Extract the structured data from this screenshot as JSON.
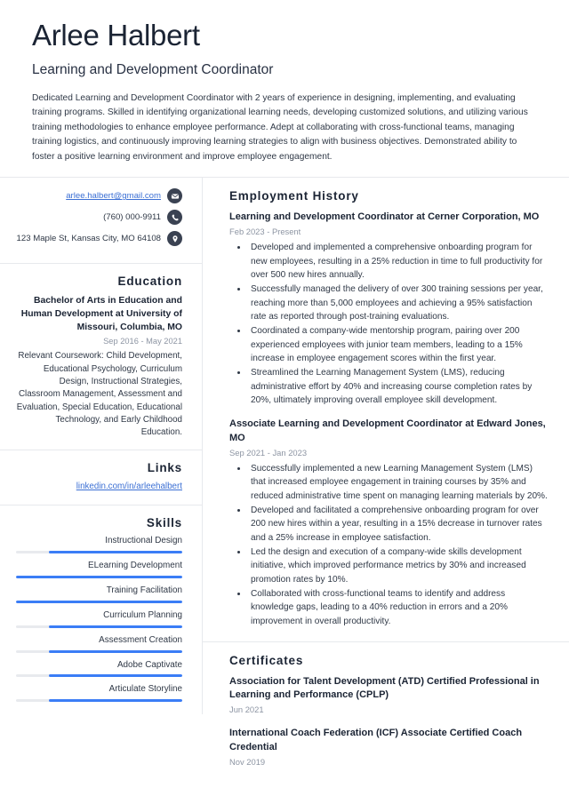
{
  "header": {
    "name": "Arlee Halbert",
    "title": "Learning and Development Coordinator",
    "summary": "Dedicated Learning and Development Coordinator with 2 years of experience in designing, implementing, and evaluating training programs. Skilled in identifying organizational learning needs, developing customized solutions, and utilizing various training methodologies to enhance employee performance. Adept at collaborating with cross-functional teams, managing training logistics, and continuously improving learning strategies to align with business objectives. Demonstrated ability to foster a positive learning environment and improve employee engagement."
  },
  "contact": {
    "email": "arlee.halbert@gmail.com",
    "phone": "(760) 000-9911",
    "address": "123 Maple St, Kansas City, MO 64108",
    "icons": {
      "email": "envelope-icon",
      "phone": "phone-icon",
      "address": "map-pin-icon"
    }
  },
  "education": {
    "heading": "Education",
    "degree": "Bachelor of Arts in Education and Human Development at University of Missouri, Columbia, MO",
    "date": "Sep 2016 - May 2021",
    "description": "Relevant Coursework: Child Development, Educational Psychology, Curriculum Design, Instructional Strategies, Classroom Management, Assessment and Evaluation, Special Education, Educational Technology, and Early Childhood Education."
  },
  "links": {
    "heading": "Links",
    "items": [
      {
        "label": "linkedin.com/in/arleehalbert"
      }
    ]
  },
  "skills": {
    "heading": "Skills",
    "accent_color": "#3b7df6",
    "track_color": "#e8eaee",
    "items": [
      {
        "name": "Instructional Design",
        "level": 80
      },
      {
        "name": "ELearning Development",
        "level": 100
      },
      {
        "name": "Training Facilitation",
        "level": 100
      },
      {
        "name": "Curriculum Planning",
        "level": 80
      },
      {
        "name": "Assessment Creation",
        "level": 80
      },
      {
        "name": "Adobe Captivate",
        "level": 80
      },
      {
        "name": "Articulate Storyline",
        "level": 80
      }
    ]
  },
  "employment": {
    "heading": "Employment History",
    "entries": [
      {
        "title": "Learning and Development Coordinator at Cerner Corporation, MO",
        "date": "Feb 2023 - Present",
        "bullets": [
          "Developed and implemented a comprehensive onboarding program for new employees, resulting in a 25% reduction in time to full productivity for over 500 new hires annually.",
          "Successfully managed the delivery of over 300 training sessions per year, reaching more than 5,000 employees and achieving a 95% satisfaction rate as reported through post-training evaluations.",
          "Coordinated a company-wide mentorship program, pairing over 200 experienced employees with junior team members, leading to a 15% increase in employee engagement scores within the first year.",
          "Streamlined the Learning Management System (LMS), reducing administrative effort by 40% and increasing course completion rates by 20%, ultimately improving overall employee skill development."
        ]
      },
      {
        "title": "Associate Learning and Development Coordinator at Edward Jones, MO",
        "date": "Sep 2021 - Jan 2023",
        "bullets": [
          "Successfully implemented a new Learning Management System (LMS) that increased employee engagement in training courses by 35% and reduced administrative time spent on managing learning materials by 20%.",
          "Developed and facilitated a comprehensive onboarding program for over 200 new hires within a year, resulting in a 15% decrease in turnover rates and a 25% increase in employee satisfaction.",
          "Led the design and execution of a company-wide skills development initiative, which improved performance metrics by 30% and increased promotion rates by 10%.",
          "Collaborated with cross-functional teams to identify and address knowledge gaps, leading to a 40% reduction in errors and a 20% improvement in overall productivity."
        ]
      }
    ]
  },
  "certificates": {
    "heading": "Certificates",
    "entries": [
      {
        "title": "Association for Talent Development (ATD) Certified Professional in Learning and Performance (CPLP)",
        "date": "Jun 2021"
      },
      {
        "title": "International Coach Federation (ICF) Associate Certified Coach Credential",
        "date": "Nov 2019"
      }
    ]
  }
}
